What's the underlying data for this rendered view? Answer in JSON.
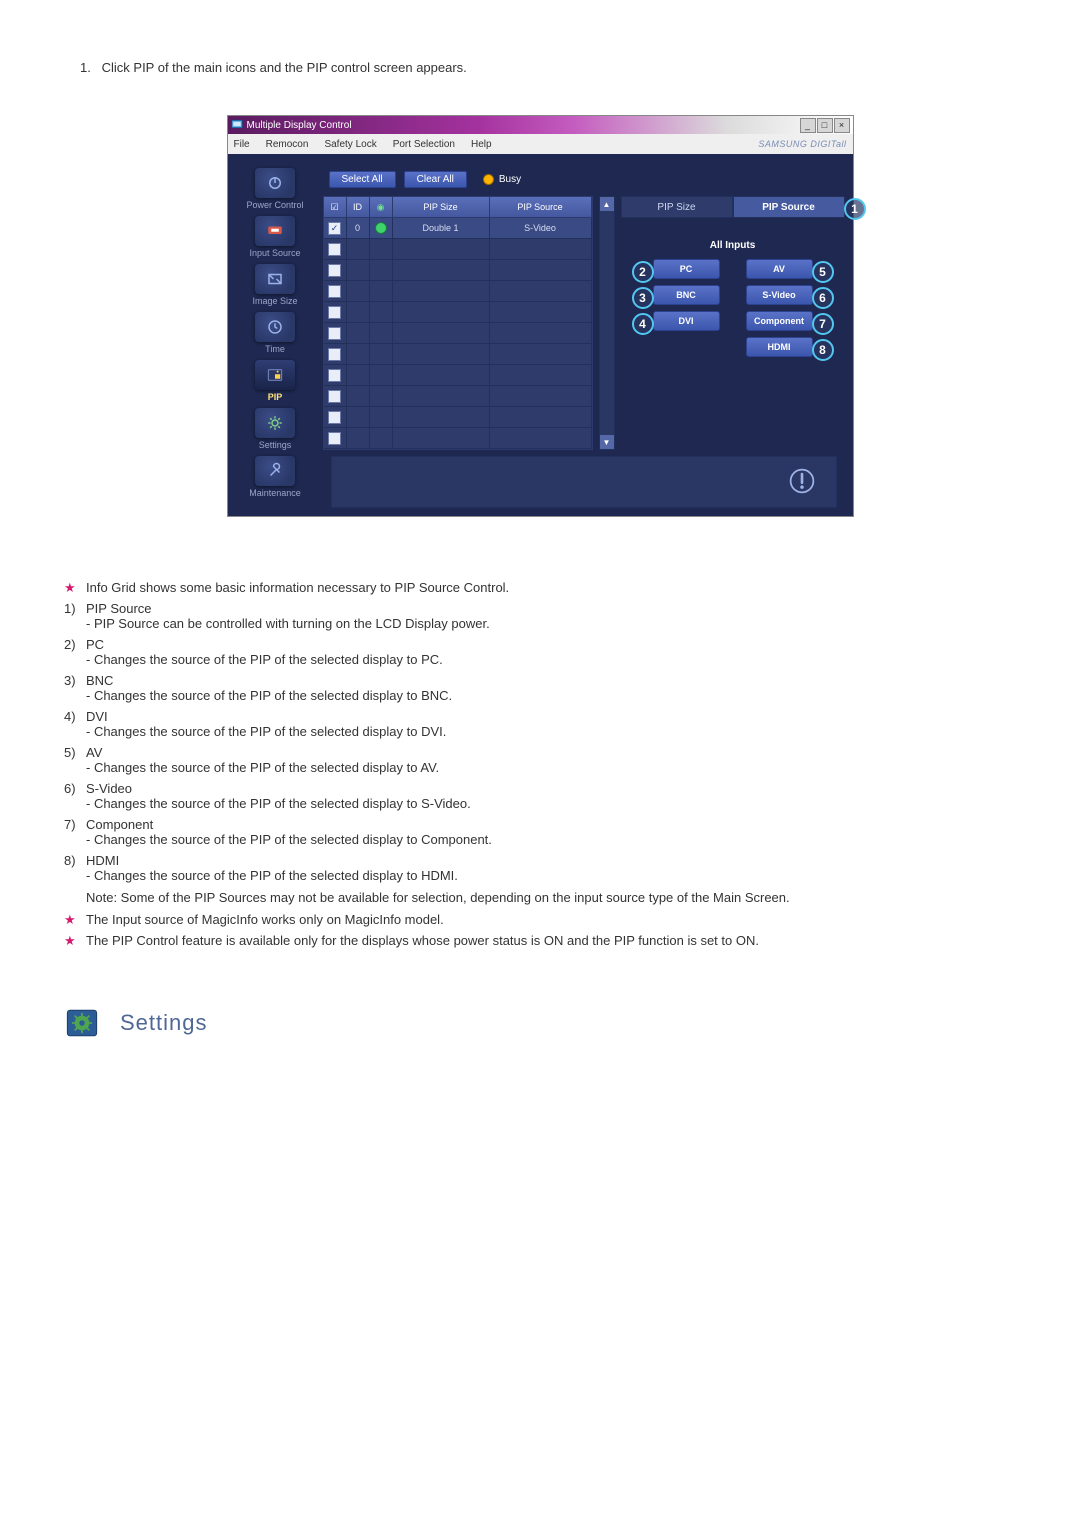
{
  "intro": {
    "num": "1.",
    "text": "Click PIP of the main icons and the PIP control screen appears."
  },
  "window": {
    "title": "Multiple Display Control",
    "brand": "SAMSUNG DIGITall",
    "menu": [
      "File",
      "Remocon",
      "Safety Lock",
      "Port Selection",
      "Help"
    ],
    "buttons": {
      "select_all": "Select All",
      "clear_all": "Clear All"
    },
    "busy_label": "Busy",
    "sidebar": [
      {
        "label": "Power Control"
      },
      {
        "label": "Input Source"
      },
      {
        "label": "Image Size"
      },
      {
        "label": "Time"
      },
      {
        "label": "PIP"
      },
      {
        "label": "Settings"
      },
      {
        "label": "Maintenance"
      }
    ],
    "grid": {
      "headers": {
        "chk": "☑",
        "id": "ID",
        "status": "●",
        "size": "PIP Size",
        "source": "PIP Source"
      },
      "rows": [
        {
          "checked": true,
          "id": "0",
          "status": "on",
          "size": "Double 1",
          "source": "S-Video"
        },
        {
          "checked": false
        },
        {
          "checked": false
        },
        {
          "checked": false
        },
        {
          "checked": false
        },
        {
          "checked": false
        },
        {
          "checked": false
        },
        {
          "checked": false
        },
        {
          "checked": false
        },
        {
          "checked": false
        },
        {
          "checked": false
        }
      ]
    },
    "tabs": {
      "size": "PIP Size",
      "source": "PIP Source"
    },
    "inputs_title": "All Inputs",
    "inputs": {
      "pc": "PC",
      "av": "AV",
      "bnc": "BNC",
      "svideo": "S-Video",
      "dvi": "DVI",
      "component": "Component",
      "hdmi": "HDMI"
    },
    "callouts": {
      "source_tab": "1",
      "pc": "2",
      "bnc": "3",
      "dvi": "4",
      "av": "5",
      "svideo": "6",
      "component": "7",
      "hdmi": "8"
    }
  },
  "notes": {
    "star1": "Info Grid shows some basic information necessary to PIP Source Control.",
    "items": [
      {
        "idx": "1)",
        "title": "PIP Source",
        "desc": "- PIP Source can be controlled with turning on the LCD Display power."
      },
      {
        "idx": "2)",
        "title": "PC",
        "desc": "- Changes the source of the PIP of the selected display to PC."
      },
      {
        "idx": "3)",
        "title": "BNC",
        "desc": "- Changes the source of the PIP of the selected display to BNC."
      },
      {
        "idx": "4)",
        "title": "DVI",
        "desc": "- Changes the source of the PIP of the selected display to DVI."
      },
      {
        "idx": "5)",
        "title": "AV",
        "desc": "- Changes the source of the PIP of the selected display to AV."
      },
      {
        "idx": "6)",
        "title": "S-Video",
        "desc": "- Changes the source of the PIP of the selected display to S-Video."
      },
      {
        "idx": "7)",
        "title": "Component",
        "desc": "- Changes the source of the PIP of the selected display to Component."
      },
      {
        "idx": "8)",
        "title": "HDMI",
        "desc": "- Changes the source of the PIP of the selected display to HDMI."
      }
    ],
    "note_line": "Note: Some of the PIP Sources may not be available for selection, depending on the input source type of the Main Screen.",
    "star2": "The Input source of MagicInfo works only on MagicInfo model.",
    "star3": "The PIP Control feature is available only for the displays whose power status is ON and the PIP function is set to ON."
  },
  "settings_heading": "Settings"
}
